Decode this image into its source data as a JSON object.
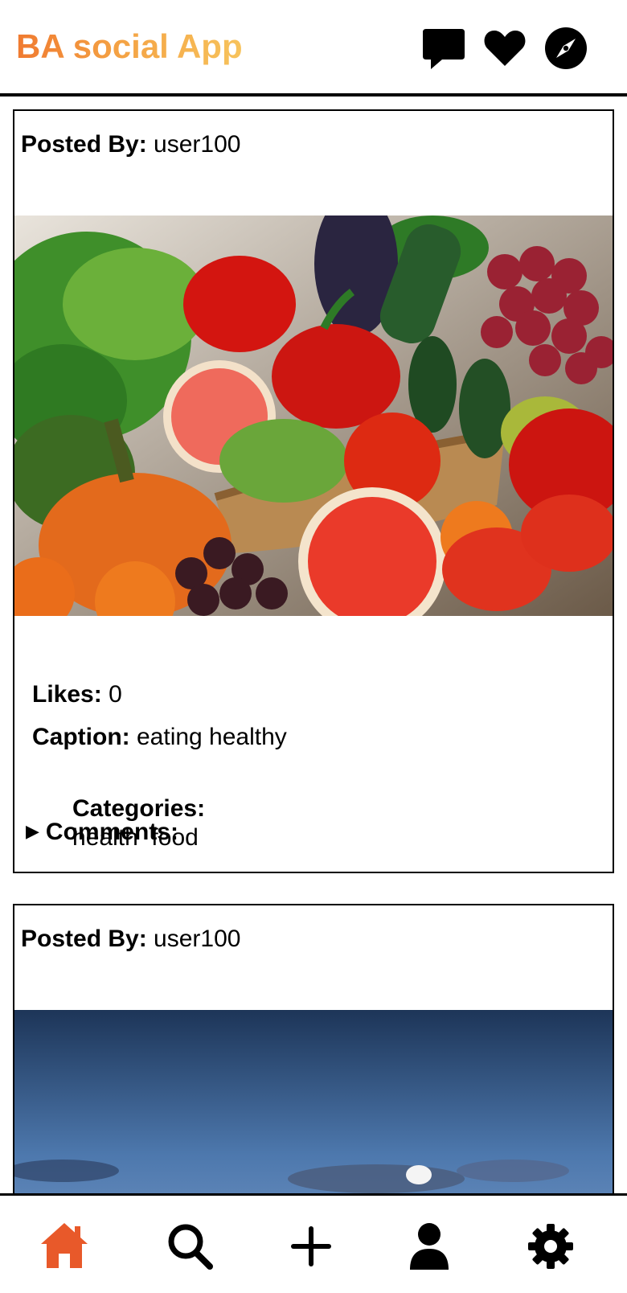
{
  "app": {
    "title": "BA social App",
    "brand_gradient": [
      "#f07a30",
      "#f7c35c"
    ]
  },
  "header": {
    "icons": [
      "chat-icon",
      "heart-icon",
      "compass-icon"
    ]
  },
  "posts": [
    {
      "posted_by_label": "Posted By:",
      "posted_by": "user100",
      "image": "vegetables-and-fruits-photo",
      "likes_label": "Likes:",
      "likes": "0",
      "caption_label": "Caption:",
      "caption": "eating healthy",
      "categories_label": "Categories:",
      "categories": "health  food",
      "comments_label": "Comments:"
    },
    {
      "posted_by_label": "Posted By:",
      "posted_by": "user100",
      "image": "airplane-in-sky-photo"
    }
  ],
  "bottom_nav": {
    "items": [
      "home-icon",
      "search-icon",
      "add-icon",
      "profile-icon",
      "settings-icon"
    ],
    "active": "home-icon",
    "active_color": "#e8592a"
  }
}
